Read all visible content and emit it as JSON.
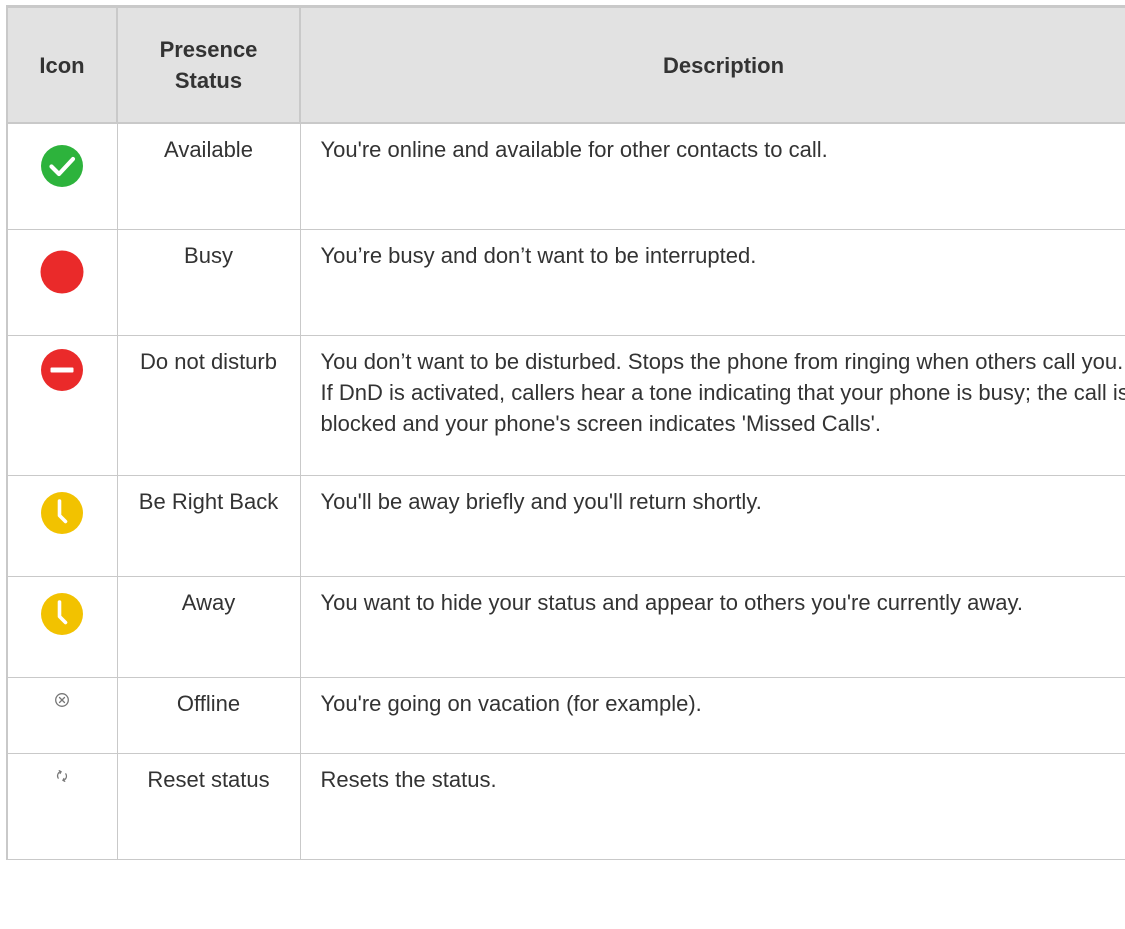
{
  "table": {
    "headers": {
      "icon": "Icon",
      "status": "Presence Status",
      "description": "Description"
    },
    "rows": [
      {
        "icon": "green-check-circle-icon",
        "status": "Available",
        "description": "You're online and available for other contacts to call."
      },
      {
        "icon": "red-circle-icon",
        "status": "Busy",
        "description": "You’re busy and don’t want to be interrupted."
      },
      {
        "icon": "red-minus-circle-icon",
        "status": "Do not disturb",
        "description": "You don’t want to be disturbed. Stops the phone from ringing when others call you. If DnD is activated, callers hear a tone indicating that your phone is busy; the call is blocked and your phone's screen indicates 'Missed Calls'."
      },
      {
        "icon": "yellow-clock-icon",
        "status": "Be Right Back",
        "description": "You'll be away briefly and you'll return shortly."
      },
      {
        "icon": "yellow-clock-icon",
        "status": "Away",
        "description": "You want to hide your status and appear to others you're currently away."
      },
      {
        "icon": "circled-x-icon",
        "status": "Offline",
        "description": "You're going on vacation (for example)."
      },
      {
        "icon": "refresh-icon",
        "status": "Reset status",
        "description": "Resets the status."
      }
    ]
  },
  "colors": {
    "available": "#2db33c",
    "busy": "#ea2a2a",
    "away": "#f2c200",
    "header_bg": "#e2e2e2",
    "border": "#c9c9c9",
    "text": "#333333"
  }
}
